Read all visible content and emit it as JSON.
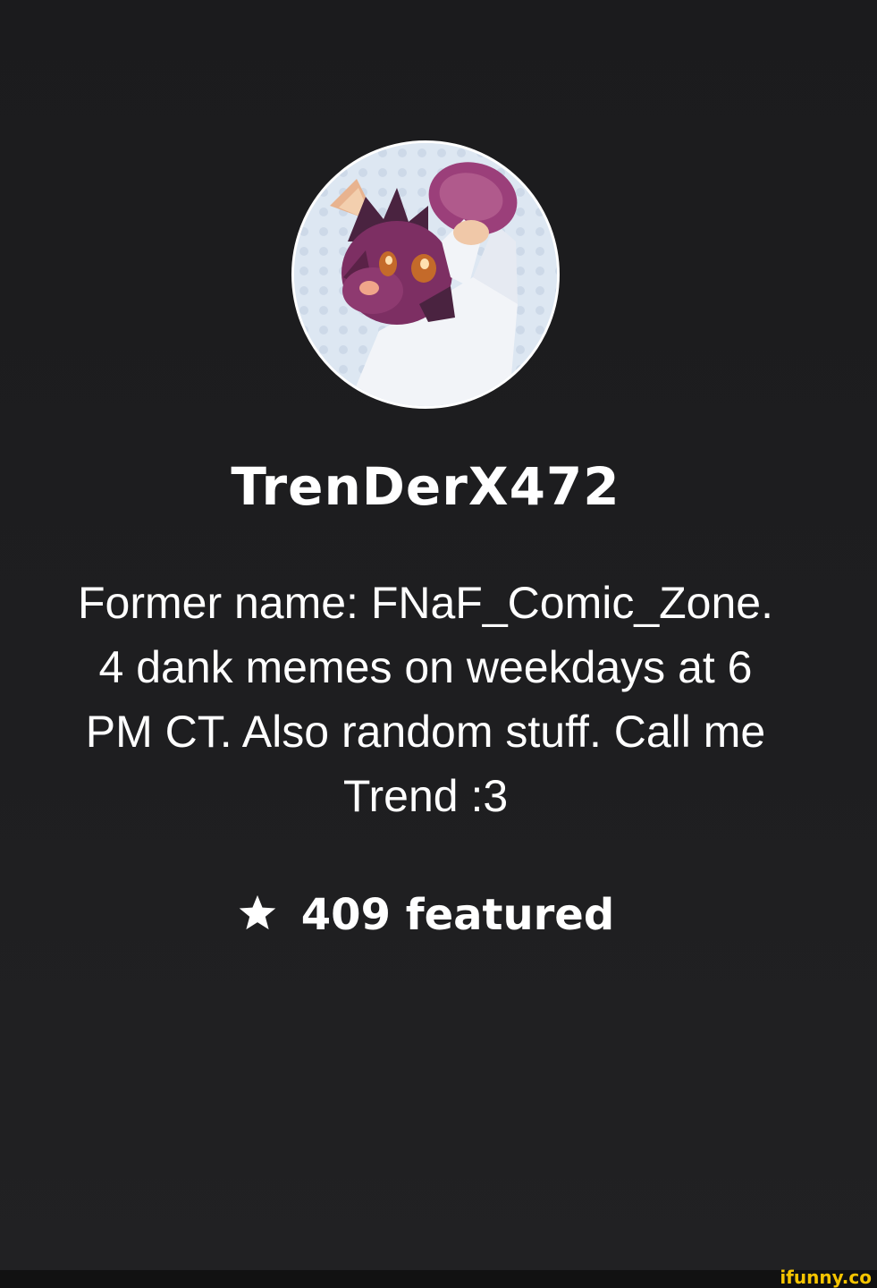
{
  "profile": {
    "username": "TrenDerX472",
    "bio_lines": [
      "Former name: FNaF_Comic_Zone.",
      "4 dank memes on weekdays at 6",
      "PM CT. Also random stuff. Call me",
      "Trend :3"
    ],
    "featured_text": "409 featured",
    "featured_icon": "star-icon",
    "avatar_icon": "avatar"
  },
  "watermark": {
    "text": "ifunny.co",
    "color": "#f5c400"
  },
  "colors": {
    "background": "#1c1c1e",
    "text": "#ffffff"
  }
}
